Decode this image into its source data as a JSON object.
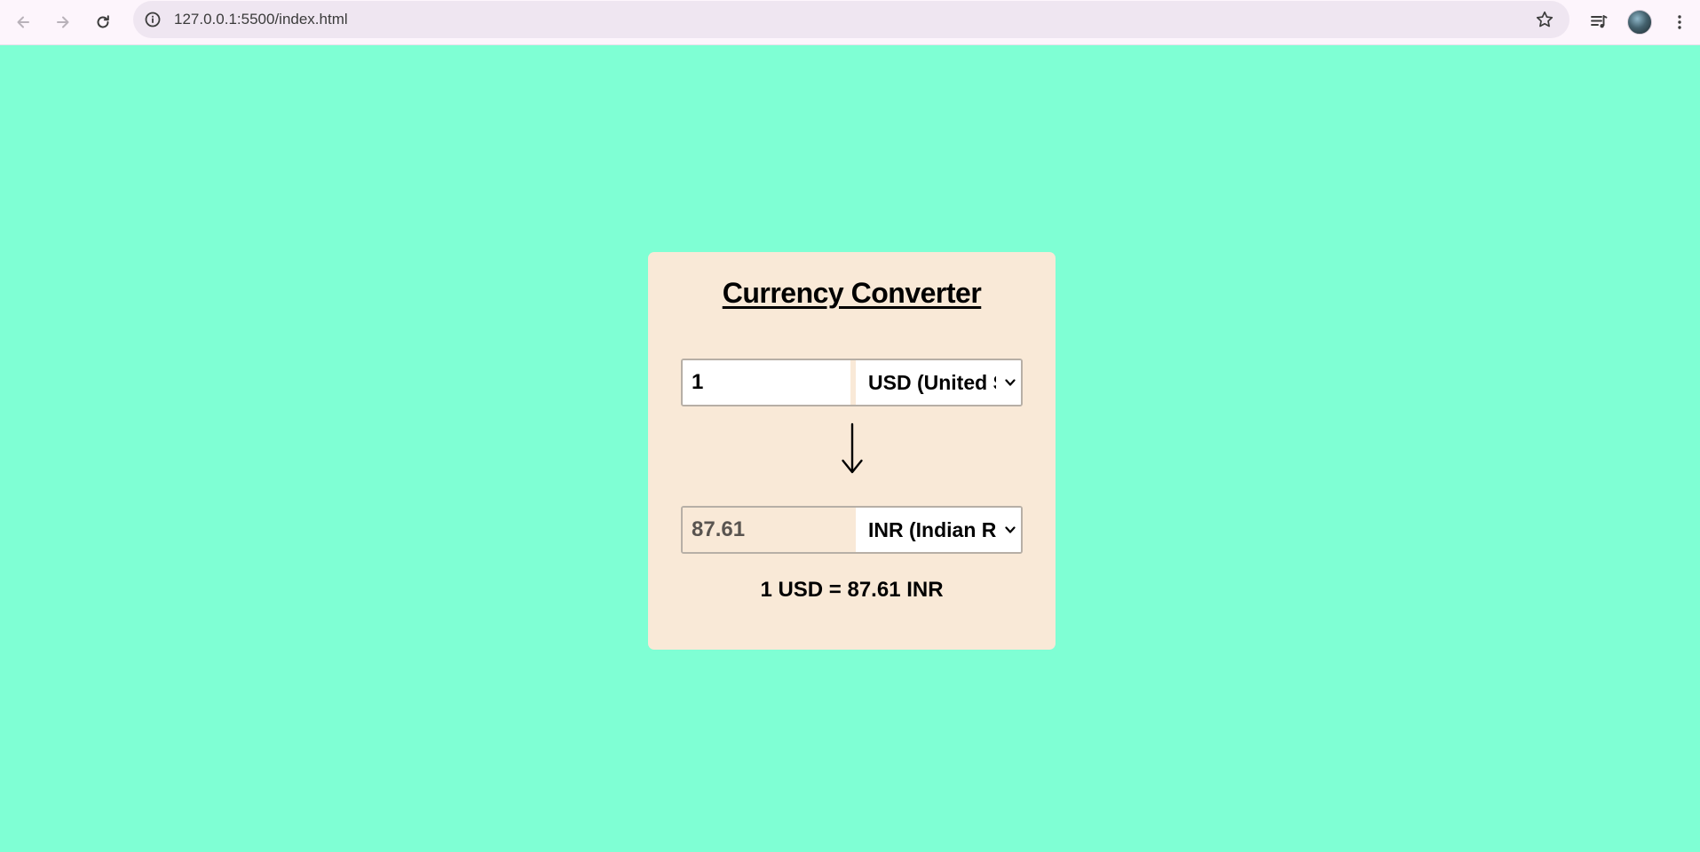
{
  "browser": {
    "url": "127.0.0.1:5500/index.html"
  },
  "converter": {
    "title": "Currency Converter",
    "from": {
      "amount": "1",
      "currency": "USD (United States Dollar)"
    },
    "to": {
      "amount": "87.61",
      "currency": "INR (Indian Rupee)"
    },
    "rate_text": "1 USD = 87.61 INR"
  },
  "colors": {
    "page_background": "#7fffd4",
    "card_background": "#f9e9d7",
    "browser_chrome": "#fdf5fc",
    "omnibox": "#efe6f1"
  },
  "icons": {
    "back": "arrow-left-icon",
    "forward": "arrow-right-icon",
    "reload": "reload-icon",
    "site_info": "info-circle-icon",
    "bookmark": "star-icon",
    "reading_list": "media-list-icon",
    "profile": "avatar",
    "menu": "kebab-menu-icon",
    "swap_arrow": "arrow-down-icon",
    "dropdown": "chevron-down-icon"
  }
}
